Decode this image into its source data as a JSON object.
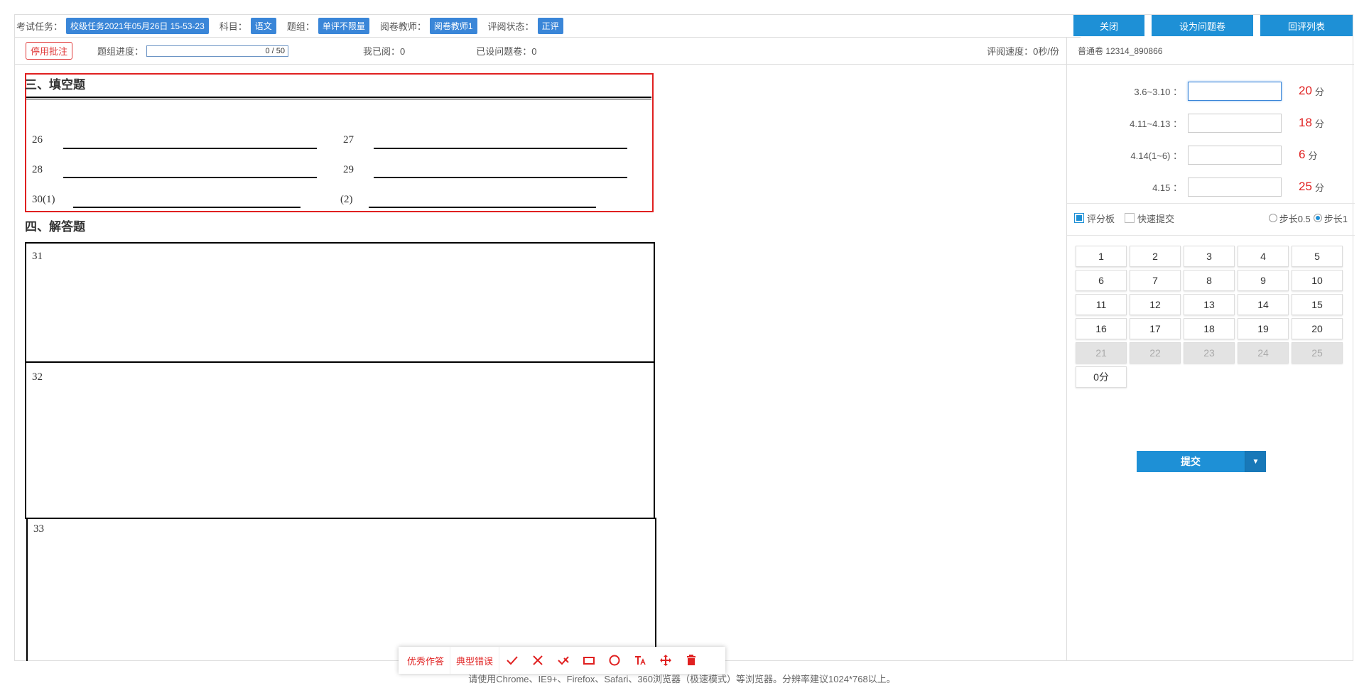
{
  "header": {
    "task_label": "考试任务：",
    "task_value": "校级任务2021年05月26日 15-53-23",
    "subject_label": "科目：",
    "subject_value": "语文",
    "group_label": "题组：",
    "group_value": "单评不限量",
    "teacher_label": "阅卷教师：",
    "teacher_value": "阅卷教师1",
    "status_label": "评阅状态：",
    "status_value": "正评",
    "buttons": {
      "close": "关闭",
      "set_problem": "设为问题卷",
      "review_list": "回评列表"
    }
  },
  "statusbar": {
    "stop_annotate": "停用批注",
    "progress_label": "题组进度：",
    "progress_text": "0 / 50",
    "progress_fraction": 0,
    "my_read": "我已阅：0",
    "problem_set": "已设问题卷：0",
    "speed": "评阅速度：0秒/份",
    "paper_no": "普通卷 12314_890866"
  },
  "sheet": {
    "section3": "三、填空题",
    "section4": "四、解答题",
    "blanks": [
      "26",
      "27",
      "28",
      "29",
      "30(1)",
      "(2)"
    ],
    "answers": [
      "31",
      "32",
      "33"
    ]
  },
  "scoring": {
    "items": [
      {
        "label": "3.6~3.10 ：",
        "max": "20",
        "unit": "分"
      },
      {
        "label": "4.11~4.13 ：",
        "max": "18",
        "unit": "分"
      },
      {
        "label": "4.14(1~6) ：",
        "max": "6",
        "unit": "分"
      },
      {
        "label": "4.15 ：",
        "max": "25",
        "unit": "分"
      }
    ],
    "score_board": "评分板",
    "quick_submit": "快速提交",
    "step_half": "步长0.5",
    "step_one": "步长1",
    "keys": [
      "1",
      "2",
      "3",
      "4",
      "5",
      "6",
      "7",
      "8",
      "9",
      "10",
      "11",
      "12",
      "13",
      "14",
      "15",
      "16",
      "17",
      "18",
      "19",
      "20",
      "21",
      "22",
      "23",
      "24",
      "25"
    ],
    "zero": "0分",
    "submit": "提交"
  },
  "tools": {
    "excellent": "优秀作答",
    "typical_error": "典型错误"
  },
  "footer": "请使用Chrome、IE9+、Firefox、Safari、360浏览器（极速模式）等浏览器。分辨率建议1024*768以上。",
  "colors": {
    "accent": "#1e90d6",
    "tag": "#3a86d8",
    "red": "#e02020"
  }
}
